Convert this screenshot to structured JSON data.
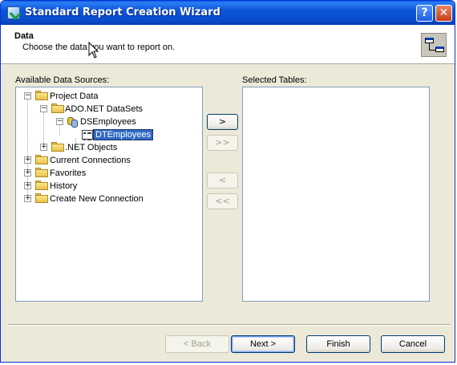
{
  "window": {
    "title": "Standard Report Creation Wizard",
    "help_glyph": "?",
    "close_glyph": "✕"
  },
  "header": {
    "title": "Data",
    "subtitle": "Choose the data you want to report on.",
    "icon": "table-link-icon"
  },
  "labels": {
    "available": "Available Data Sources:",
    "selected": "Selected Tables:"
  },
  "tree": {
    "project_data": "Project Data",
    "ado_datasets": "ADO.NET DataSets",
    "ds_employees": "DSEmployees",
    "dt_employees": "DTEmployees",
    "net_objects": ".NET Objects",
    "current_connections": "Current Connections",
    "favorites": "Favorites",
    "history": "History",
    "create_new": "Create New Connection",
    "expand_glyph": "+",
    "collapse_glyph": "−"
  },
  "move_buttons": {
    "add": ">",
    "add_all": ">>",
    "remove": "<",
    "remove_all": "<<"
  },
  "footer": {
    "back": "< Back",
    "next": "Next >",
    "finish": "Finish",
    "cancel": "Cancel"
  },
  "colors": {
    "title_bar": "#0a4ccc",
    "selection": "#316ac5",
    "dialog_face": "#ece9d8"
  }
}
